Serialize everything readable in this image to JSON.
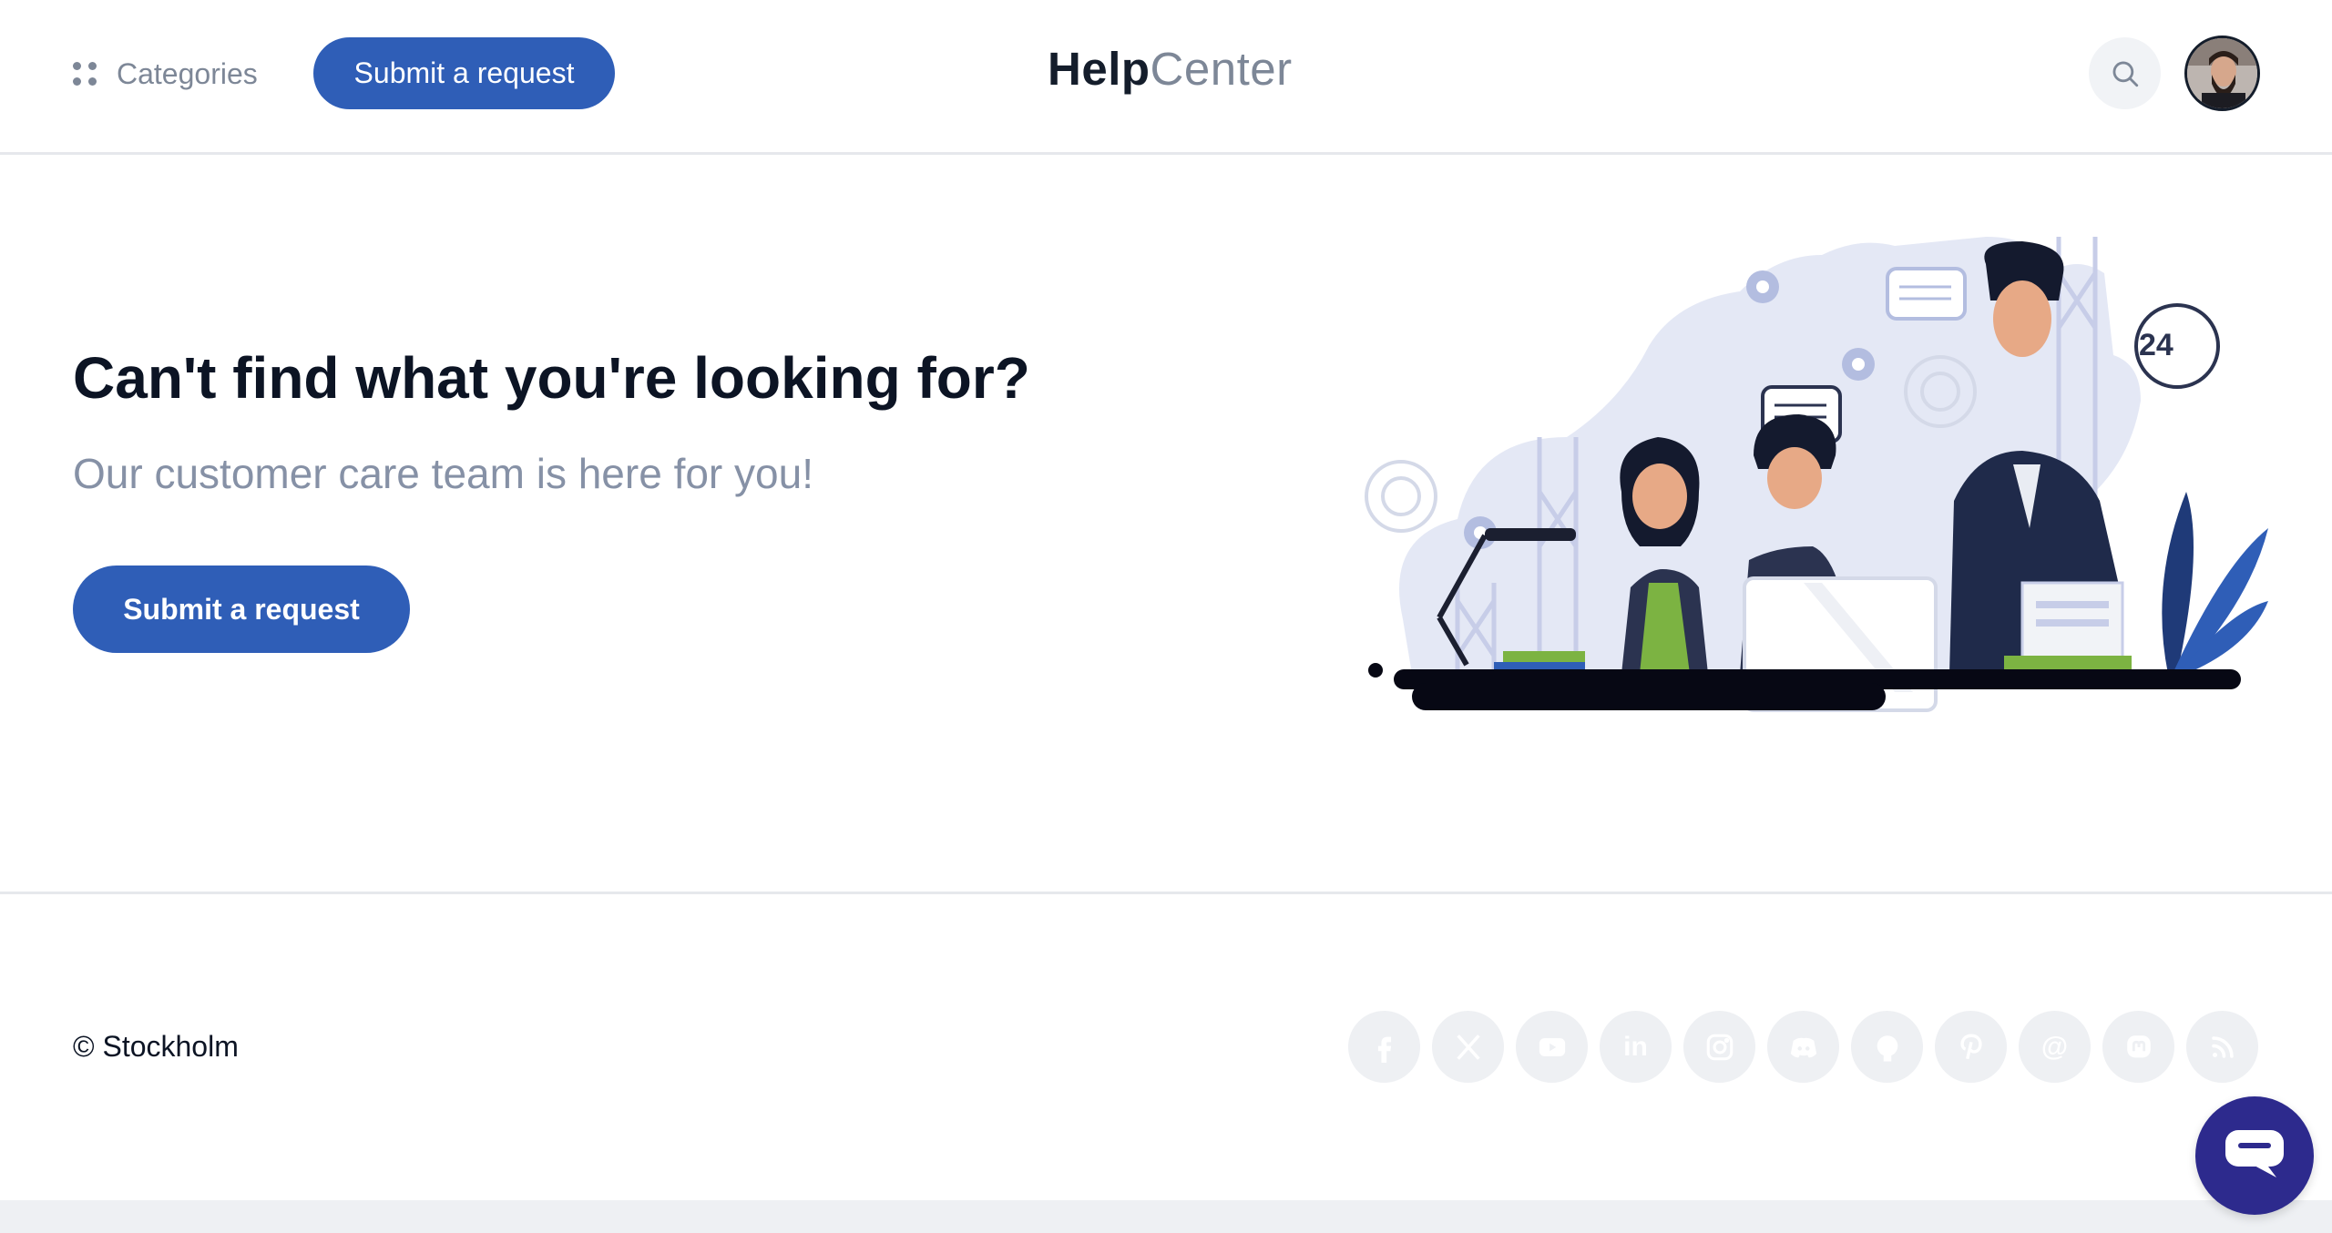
{
  "header": {
    "categories_label": "Categories",
    "submit_label": "Submit a request",
    "logo_bold": "Help",
    "logo_light": "Center"
  },
  "hero": {
    "title": "Can't find what you're looking for?",
    "subtitle": "Our customer care team is here for you!",
    "button_label": "Submit a request",
    "illustration_badge": "24"
  },
  "footer": {
    "copyright": "© Stockholm",
    "socials": [
      {
        "icon": "facebook-icon"
      },
      {
        "icon": "x-icon"
      },
      {
        "icon": "youtube-icon"
      },
      {
        "icon": "linkedin-icon",
        "text": "in"
      },
      {
        "icon": "instagram-icon"
      },
      {
        "icon": "discord-icon"
      },
      {
        "icon": "github-icon"
      },
      {
        "icon": "pinterest-icon"
      },
      {
        "icon": "threads-icon",
        "text": "@"
      },
      {
        "icon": "mastodon-icon"
      },
      {
        "icon": "rss-icon"
      }
    ]
  },
  "colors": {
    "primary": "#2f5eb7",
    "chat": "#2d2a8d",
    "muted": "#7d8797",
    "social_bg": "#eef0f3"
  }
}
